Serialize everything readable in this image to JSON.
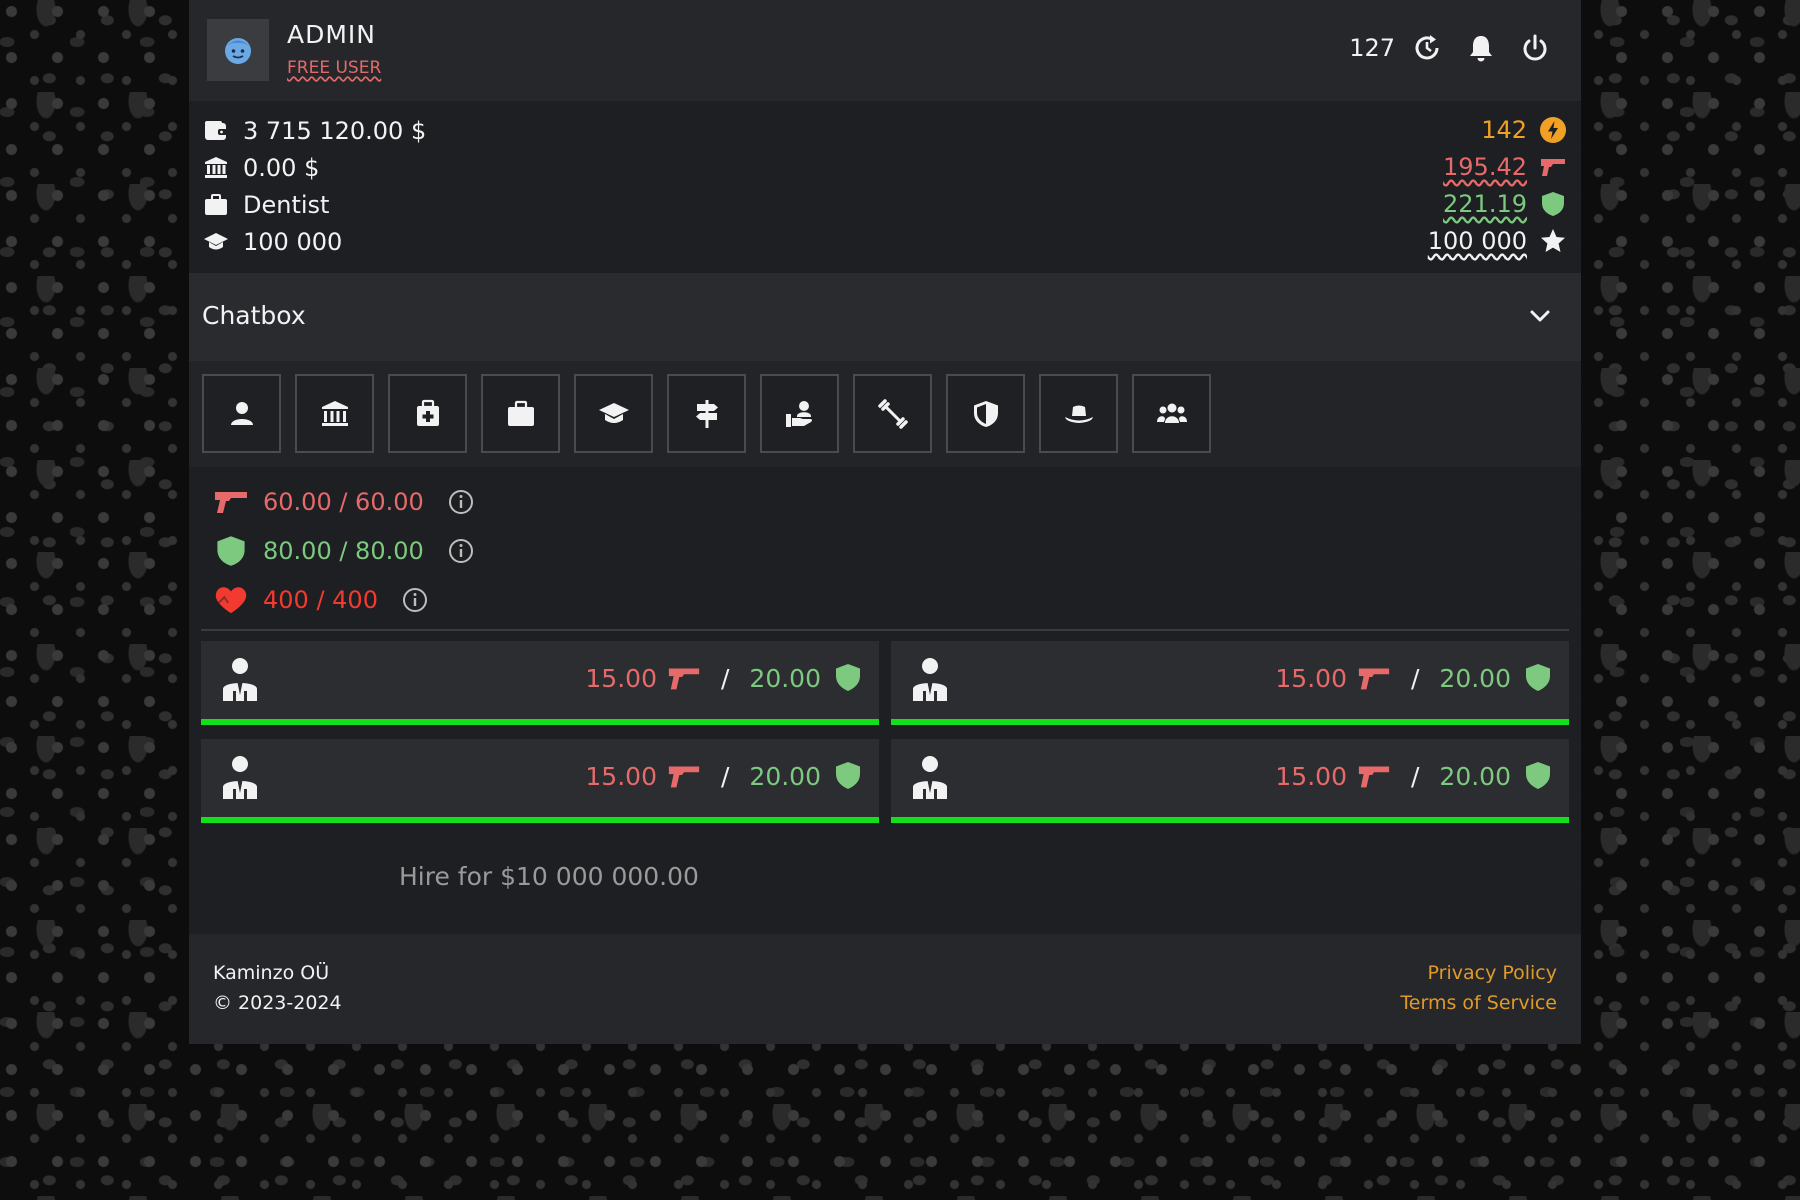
{
  "user": {
    "name": "ADMIN",
    "type": "FREE USER"
  },
  "header": {
    "count": "127"
  },
  "stats": {
    "cash": "3 715 120.00 $",
    "bank": "0.00 $",
    "job": "Dentist",
    "education": "100 000",
    "energy": "142",
    "attack": "195.42",
    "defense": "221.19",
    "experience": "100 000"
  },
  "chatbox": {
    "title": "Chatbox"
  },
  "nav": [
    {
      "icon": "person-icon"
    },
    {
      "icon": "bank-icon"
    },
    {
      "icon": "medkit-icon"
    },
    {
      "icon": "briefcase-icon"
    },
    {
      "icon": "graduation-cap-icon"
    },
    {
      "icon": "signpost-icon"
    },
    {
      "icon": "hand-holding-person-icon"
    },
    {
      "icon": "dumbbell-icon"
    },
    {
      "icon": "shield-icon"
    },
    {
      "icon": "hat-icon"
    },
    {
      "icon": "group-icon"
    }
  ],
  "combat": {
    "attack": "60.00 / 60.00",
    "defense": "80.00 / 80.00",
    "health": "400 / 400"
  },
  "guards": [
    {
      "attack": "15.00",
      "defense": "20.00"
    },
    {
      "attack": "15.00",
      "defense": "20.00"
    },
    {
      "attack": "15.00",
      "defense": "20.00"
    },
    {
      "attack": "15.00",
      "defense": "20.00"
    }
  ],
  "hire_label": "Hire for $10 000 000.00",
  "footer": {
    "company": "Kaminzo OÜ",
    "copyright": "© 2023-2024",
    "privacy": "Privacy Policy",
    "terms": "Terms of Service"
  },
  "colors": {
    "attack": "#e66a6a",
    "defense": "#7cc97f",
    "health": "#f23a30",
    "energy": "#f0a024",
    "guard_bar": "#14e01a",
    "link": "#e09a2a"
  }
}
